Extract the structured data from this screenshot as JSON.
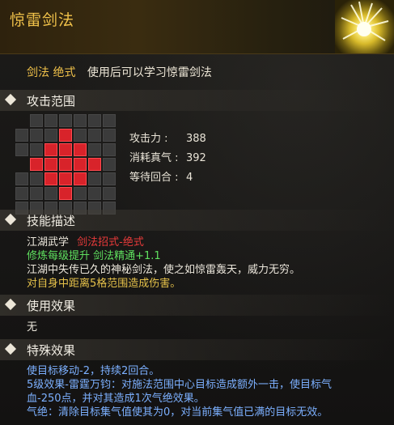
{
  "skill": {
    "title": "惊雷剑法",
    "type_label": "剑法 绝式",
    "type_desc": "使用后可以学习惊雷剑法"
  },
  "sections": {
    "attack_range": "攻击范围",
    "skill_desc": "技能描述",
    "use_effect": "使用效果",
    "special_effect": "特殊效果"
  },
  "stats": [
    {
      "label": "攻击力 :",
      "value": "388"
    },
    {
      "label": "消耗真气 :",
      "value": "392"
    },
    {
      "label": "等待回合 :",
      "value": "4"
    }
  ],
  "range_grid": [
    [
      "empty",
      "dark",
      "dark",
      "dark",
      "dark",
      "dark",
      "dark"
    ],
    [
      "dark",
      "dark",
      "dark",
      "red",
      "dark",
      "dark",
      "dark"
    ],
    [
      "dark",
      "dark",
      "red",
      "red",
      "red",
      "dark",
      "dark"
    ],
    [
      "empty",
      "red",
      "red",
      "red",
      "red",
      "red",
      "dark"
    ],
    [
      "dark",
      "dark",
      "red",
      "red",
      "red",
      "dark",
      "dark"
    ],
    [
      "dark",
      "dark",
      "dark",
      "red",
      "dark",
      "dark",
      "dark"
    ],
    [
      "dark",
      "dark",
      "dark",
      "dark",
      "dark",
      "dark",
      "dark"
    ]
  ],
  "description": {
    "line1_prefix": "江湖武学",
    "line1_tag": "剑法招式-绝式",
    "line2": "修炼每级提升 剑法精通+1.1",
    "line3": "江湖中失传已久的神秘剑法，使之如惊雷轰天，威力无穷。",
    "line4": "对自身中距离5格范围造成伤害。"
  },
  "use_effect_text": "无",
  "special_effect": {
    "line1": "使目标移动-2，持续2回合。",
    "line2": "5级效果-雷霆万钧：对施法范围中心目标造成额外一击，使目标气",
    "line3": "血-250点，并对其造成1次气绝效果。",
    "line4": "气绝：清除目标集气值使其为0，对当前集气值已满的目标无效。"
  },
  "colors": {
    "title": "#f1c24a",
    "range_red": "#d8232a",
    "tag_red": "#e83a3a",
    "green": "#5fe05f",
    "yellow": "#e6c24a",
    "blue": "#7cb0ff"
  },
  "icons": {
    "skill_icon": "lightning-burst-icon",
    "section_marker": "diamond-icon"
  }
}
